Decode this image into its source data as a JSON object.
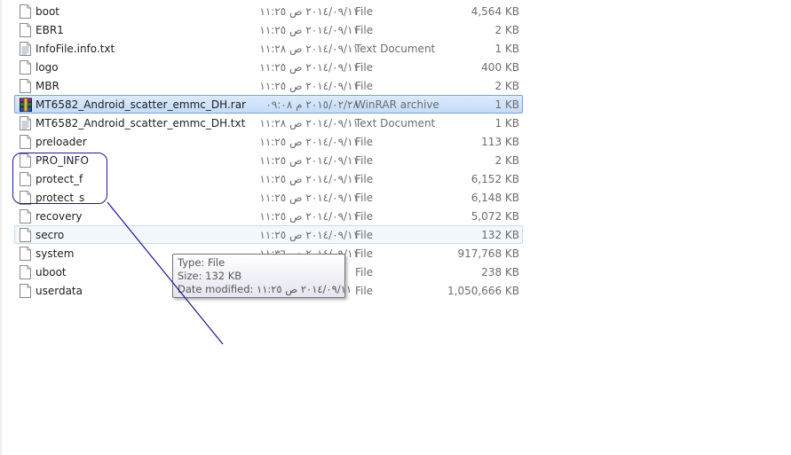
{
  "files": [
    {
      "name": "boot",
      "date": "٢٠١٤/٠٩/١١ ص ١١:٢٥",
      "type": "File",
      "size": "4,564 KB",
      "icon": "blank-file-icon",
      "state": "normal"
    },
    {
      "name": "EBR1",
      "date": "٢٠١٤/٠٩/١١ ص ١١:٢٥",
      "type": "File",
      "size": "2 KB",
      "icon": "blank-file-icon",
      "state": "normal"
    },
    {
      "name": "InfoFile.info.txt",
      "date": "٢٠١٤/٠٩/١١ ص ١١:٢٨",
      "type": "Text Document",
      "size": "1 KB",
      "icon": "text-file-icon",
      "state": "normal"
    },
    {
      "name": "logo",
      "date": "٢٠١٤/٠٩/١١ ص ١١:٢٥",
      "type": "File",
      "size": "400 KB",
      "icon": "blank-file-icon",
      "state": "normal"
    },
    {
      "name": "MBR",
      "date": "٢٠١٤/٠٩/١١ ص ١١:٢٥",
      "type": "File",
      "size": "2 KB",
      "icon": "blank-file-icon",
      "state": "normal"
    },
    {
      "name": "MT6582_Android_scatter_emmc_DH.rar",
      "date": "٢٠١٥/٠٢/٢٨ م ٠٩:٠٨",
      "type": "WinRAR archive",
      "size": "1 KB",
      "icon": "winrar-archive-icon",
      "state": "selected"
    },
    {
      "name": "MT6582_Android_scatter_emmc_DH.txt",
      "date": "٢٠١٤/٠٩/١١ ص ١١:٢٨",
      "type": "Text Document",
      "size": "1 KB",
      "icon": "text-file-icon",
      "state": "normal"
    },
    {
      "name": "preloader",
      "date": "٢٠١٤/٠٩/١١ ص ١١:٢٥",
      "type": "File",
      "size": "113 KB",
      "icon": "blank-file-icon",
      "state": "normal"
    },
    {
      "name": "PRO_INFO",
      "date": "٢٠١٤/٠٩/١١ ص ١١:٢٥",
      "type": "File",
      "size": "2 KB",
      "icon": "blank-file-icon",
      "state": "normal"
    },
    {
      "name": "protect_f",
      "date": "٢٠١٤/٠٩/١١ ص ١١:٢٥",
      "type": "File",
      "size": "6,152 KB",
      "icon": "blank-file-icon",
      "state": "normal"
    },
    {
      "name": "protect_s",
      "date": "٢٠١٤/٠٩/١١ ص ١١:٢٥",
      "type": "File",
      "size": "6,148 KB",
      "icon": "blank-file-icon",
      "state": "normal"
    },
    {
      "name": "recovery",
      "date": "٢٠١٤/٠٩/١١ ص ١١:٢٥",
      "type": "File",
      "size": "5,072 KB",
      "icon": "blank-file-icon",
      "state": "normal"
    },
    {
      "name": "secro",
      "date": "٢٠١٤/٠٩/١١ ص ١١:٢٥",
      "type": "File",
      "size": "132 KB",
      "icon": "blank-file-icon",
      "state": "hover"
    },
    {
      "name": "system",
      "date": "٢٠١٤/٠٩/١١ ص ١١:٣٦",
      "type": "File",
      "size": "917,768 KB",
      "icon": "blank-file-icon",
      "state": "normal"
    },
    {
      "name": "uboot",
      "date": "",
      "type": "File",
      "size": "238 KB",
      "icon": "blank-file-icon",
      "state": "normal"
    },
    {
      "name": "userdata",
      "date": "",
      "type": "File",
      "size": "1,050,666 KB",
      "icon": "blank-file-icon",
      "state": "normal"
    }
  ],
  "tooltip": {
    "type_line": "Type: File",
    "size_line": "Size: 132 KB",
    "date_line": "Date modified: ٢٠١٤/٠٩/١١ ص ١١:٢٥"
  },
  "colors": {
    "selected_bg": "#cce8ff",
    "annotation": "#1a1a8c"
  }
}
